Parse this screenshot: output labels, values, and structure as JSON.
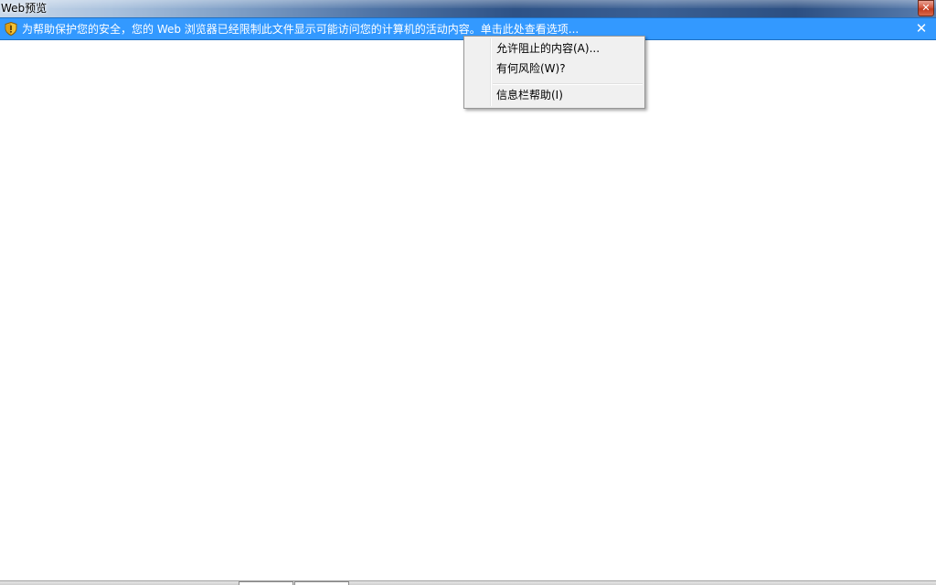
{
  "window": {
    "title": "Web预览",
    "close_label": "✕"
  },
  "infobar": {
    "icon": "shield-warning-icon",
    "message": "为帮助保护您的安全，您的 Web 浏览器已经限制此文件显示可能访问您的计算机的活动内容。单击此处查看选项...",
    "close_label": "✕",
    "color": "#3399ff"
  },
  "context_menu": {
    "items": [
      {
        "label": "允许阻止的内容(A)..."
      },
      {
        "label": "有何风险(W)?"
      },
      {
        "label": "信息栏帮助(I)"
      }
    ]
  }
}
